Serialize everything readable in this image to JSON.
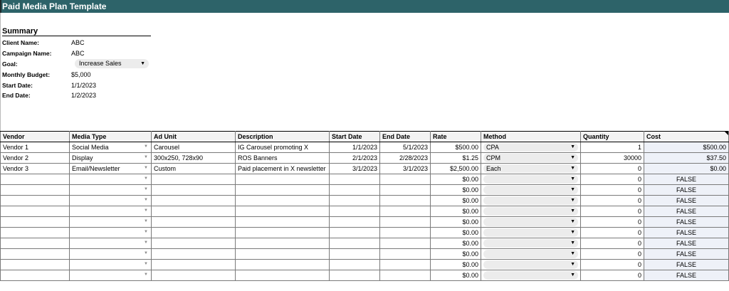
{
  "title": "Paid Media Plan Template",
  "summary": {
    "heading": "Summary",
    "rows": [
      {
        "label": "Client Name:",
        "value": "ABC"
      },
      {
        "label": "Campaign Name:",
        "value": "ABC"
      },
      {
        "label": "Goal:",
        "value": "Increase Sales"
      },
      {
        "label": "Monthly Budget:",
        "value": "$5,000"
      },
      {
        "label": "Start Date:",
        "value": "1/1/2023"
      },
      {
        "label": "End Date:",
        "value": "1/2/2023"
      }
    ]
  },
  "table": {
    "headers": [
      "Vendor",
      "Media Type",
      "Ad Unit",
      "Description",
      "Start Date",
      "End Date",
      "Rate",
      "Method",
      "Quantity",
      "Cost"
    ],
    "rows": [
      {
        "vendor": "Vendor 1",
        "media_type": "Social Media",
        "ad_unit": "Carousel",
        "description": "IG Carousel promoting X",
        "start": "1/1/2023",
        "end": "5/1/2023",
        "rate": "$500.00",
        "method": "CPA",
        "quantity": "1",
        "cost": "$500.00"
      },
      {
        "vendor": "Vendor 2",
        "media_type": "Display",
        "ad_unit": "300x250, 728x90",
        "description": "ROS Banners",
        "start": "2/1/2023",
        "end": "2/28/2023",
        "rate": "$1.25",
        "method": "CPM",
        "quantity": "30000",
        "cost": "$37.50"
      },
      {
        "vendor": "Vendor 3",
        "media_type": "Email/Newsletter",
        "ad_unit": "Custom",
        "description": "Paid placement in X newsletter",
        "start": "3/1/2023",
        "end": "3/1/2023",
        "rate": "$2,500.00",
        "method": "Each",
        "quantity": "0",
        "cost": "$0.00"
      },
      {
        "vendor": "",
        "media_type": "",
        "ad_unit": "",
        "description": "",
        "start": "",
        "end": "",
        "rate": "$0.00",
        "method": "",
        "quantity": "0",
        "cost": "FALSE"
      },
      {
        "vendor": "",
        "media_type": "",
        "ad_unit": "",
        "description": "",
        "start": "",
        "end": "",
        "rate": "$0.00",
        "method": "",
        "quantity": "0",
        "cost": "FALSE"
      },
      {
        "vendor": "",
        "media_type": "",
        "ad_unit": "",
        "description": "",
        "start": "",
        "end": "",
        "rate": "$0.00",
        "method": "",
        "quantity": "0",
        "cost": "FALSE"
      },
      {
        "vendor": "",
        "media_type": "",
        "ad_unit": "",
        "description": "",
        "start": "",
        "end": "",
        "rate": "$0.00",
        "method": "",
        "quantity": "0",
        "cost": "FALSE"
      },
      {
        "vendor": "",
        "media_type": "",
        "ad_unit": "",
        "description": "",
        "start": "",
        "end": "",
        "rate": "$0.00",
        "method": "",
        "quantity": "0",
        "cost": "FALSE"
      },
      {
        "vendor": "",
        "media_type": "",
        "ad_unit": "",
        "description": "",
        "start": "",
        "end": "",
        "rate": "$0.00",
        "method": "",
        "quantity": "0",
        "cost": "FALSE"
      },
      {
        "vendor": "",
        "media_type": "",
        "ad_unit": "",
        "description": "",
        "start": "",
        "end": "",
        "rate": "$0.00",
        "method": "",
        "quantity": "0",
        "cost": "FALSE"
      },
      {
        "vendor": "",
        "media_type": "",
        "ad_unit": "",
        "description": "",
        "start": "",
        "end": "",
        "rate": "$0.00",
        "method": "",
        "quantity": "0",
        "cost": "FALSE"
      },
      {
        "vendor": "",
        "media_type": "",
        "ad_unit": "",
        "description": "",
        "start": "",
        "end": "",
        "rate": "$0.00",
        "method": "",
        "quantity": "0",
        "cost": "FALSE"
      },
      {
        "vendor": "",
        "media_type": "",
        "ad_unit": "",
        "description": "",
        "start": "",
        "end": "",
        "rate": "$0.00",
        "method": "",
        "quantity": "0",
        "cost": "FALSE"
      }
    ]
  },
  "icons": {
    "dropdown": "caret-down-icon"
  },
  "colors": {
    "title_bar": "#2d6369",
    "cost_column": "#eef1f8",
    "chip": "#ececec"
  }
}
